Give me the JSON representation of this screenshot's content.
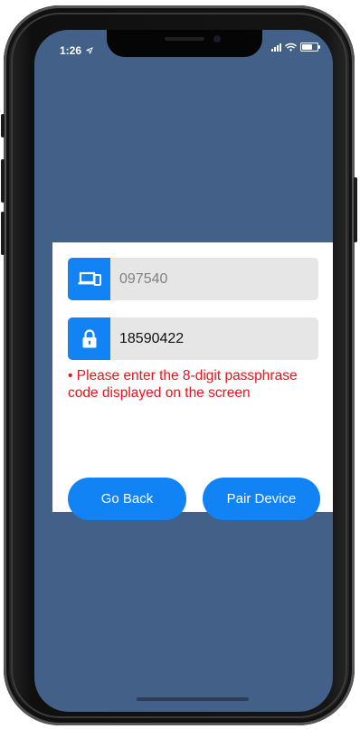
{
  "status_bar": {
    "time": "1:26",
    "location_icon": "location-arrow-icon",
    "signal_icon": "cellular-signal-icon",
    "wifi_icon": "wifi-icon",
    "battery_icon": "battery-icon"
  },
  "pairing_dialog": {
    "device_field": {
      "icon": "devices-icon",
      "value": "097540"
    },
    "passphrase_field": {
      "icon": "lock-icon",
      "value": "18590422"
    },
    "error_message": "• Please enter the 8-digit passphrase code displayed on the screen",
    "go_back_label": "Go Back",
    "pair_device_label": "Pair Device"
  },
  "colors": {
    "background": "#436089",
    "accent": "#1283f5",
    "error": "#e8141c",
    "field_bg": "#e6e6e6"
  }
}
